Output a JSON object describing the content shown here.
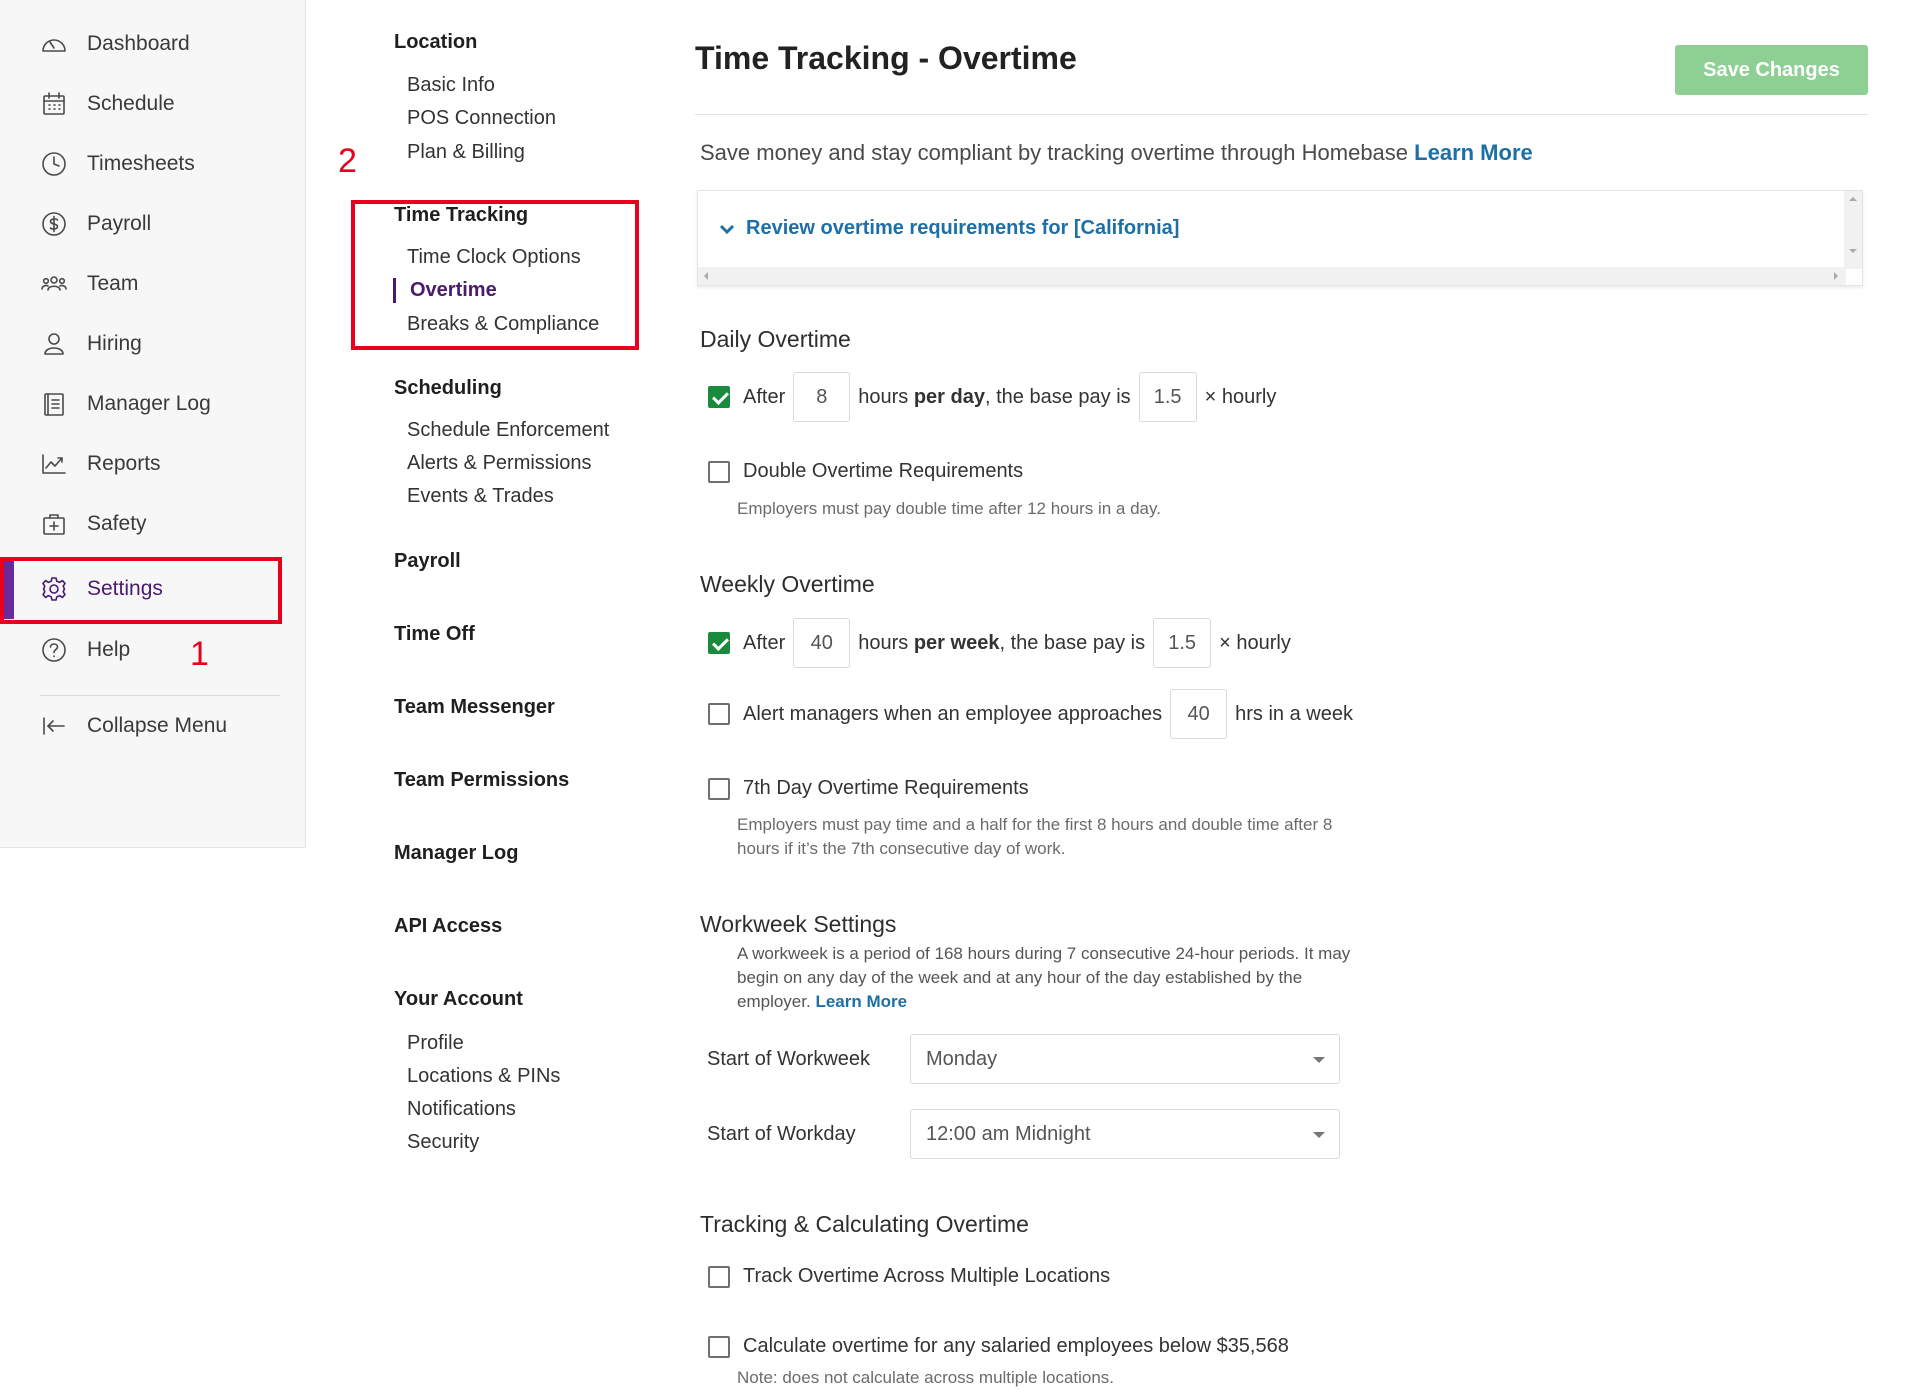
{
  "sidebar": {
    "items": [
      {
        "label": "Dashboard",
        "icon": "dashboard-icon"
      },
      {
        "label": "Schedule",
        "icon": "calendar-icon"
      },
      {
        "label": "Timesheets",
        "icon": "clock-icon"
      },
      {
        "label": "Payroll",
        "icon": "dollar-icon"
      },
      {
        "label": "Team",
        "icon": "team-icon"
      },
      {
        "label": "Hiring",
        "icon": "person-icon"
      },
      {
        "label": "Manager Log",
        "icon": "logbook-icon"
      },
      {
        "label": "Reports",
        "icon": "chart-icon"
      },
      {
        "label": "Safety",
        "icon": "first-aid-icon"
      },
      {
        "label": "Settings",
        "icon": "gear-icon"
      },
      {
        "label": "Help",
        "icon": "help-icon"
      }
    ],
    "collapse_label": "Collapse Menu",
    "active_item": "Settings",
    "accent_color": "#4a1a6e"
  },
  "annotations": {
    "step1": "1",
    "step2": "2",
    "color": "#e8001c"
  },
  "subnav": {
    "location": {
      "heading": "Location",
      "items": [
        "Basic Info",
        "POS Connection",
        "Plan & Billing"
      ]
    },
    "time_tracking": {
      "heading": "Time Tracking",
      "items": [
        "Time Clock Options",
        "Overtime",
        "Breaks & Compliance"
      ],
      "active": "Overtime"
    },
    "scheduling": {
      "heading": "Scheduling",
      "items": [
        "Schedule Enforcement",
        "Alerts & Permissions",
        "Events & Trades"
      ]
    },
    "payroll": "Payroll",
    "time_off": "Time Off",
    "team_messenger": "Team Messenger",
    "team_permissions": "Team Permissions",
    "manager_log": "Manager Log",
    "api_access": "API Access",
    "your_account": {
      "heading": "Your Account",
      "items": [
        "Profile",
        "Locations & PINs",
        "Notifications",
        "Security"
      ]
    }
  },
  "main": {
    "title": "Time Tracking - Overtime",
    "save_label": "Save Changes",
    "save_color": "#8ecf94",
    "intro_text": "Save money and stay compliant by tracking overtime through Homebase",
    "intro_link": "Learn More",
    "review_label": "Review overtime requirements for [California]",
    "daily": {
      "title": "Daily Overtime",
      "after": "After",
      "hours": "8",
      "hours_text_pre": "hours",
      "hours_text_bold": "per day",
      "hours_text_post": ", the base pay is",
      "rate": "1.5",
      "rate_suffix": "× hourly",
      "checked": true,
      "double_label": "Double Overtime Requirements",
      "double_checked": false,
      "double_note": "Employers must pay double time after 12 hours in a day."
    },
    "weekly": {
      "title": "Weekly Overtime",
      "after": "After",
      "hours": "40",
      "hours_text_pre": "hours",
      "hours_text_bold": "per week",
      "hours_text_post": ", the base pay is",
      "rate": "1.5",
      "rate_suffix": "× hourly",
      "checked": true,
      "alert_label": "Alert managers when an employee approaches",
      "alert_hours": "40",
      "alert_suffix": "hrs in a week",
      "alert_checked": false,
      "seventh_label": "7th Day Overtime Requirements",
      "seventh_checked": false,
      "seventh_note_1": "Employers must pay time and a half for the first 8 hours and double time after 8",
      "seventh_note_2": "hours if it’s the 7th consecutive day of work."
    },
    "workweek": {
      "title": "Workweek Settings",
      "note_1": "A workweek is a period of 168 hours during 7 consecutive 24-hour periods. It may",
      "note_2": "begin on any day of the week and at any hour of the day established by the",
      "note_3": "employer.",
      "note_link": "Learn More",
      "start_week_label": "Start of Workweek",
      "start_week_value": "Monday",
      "start_day_label": "Start of Workday",
      "start_day_value": "12:00 am Midnight"
    },
    "tracking": {
      "title": "Tracking & Calculating Overtime",
      "multi_label": "Track Overtime Across Multiple Locations",
      "multi_checked": false,
      "salaried_label": "Calculate overtime for any salaried employees below $35,568",
      "salaried_checked": false,
      "salaried_note": "Note: does not calculate across multiple locations."
    }
  }
}
